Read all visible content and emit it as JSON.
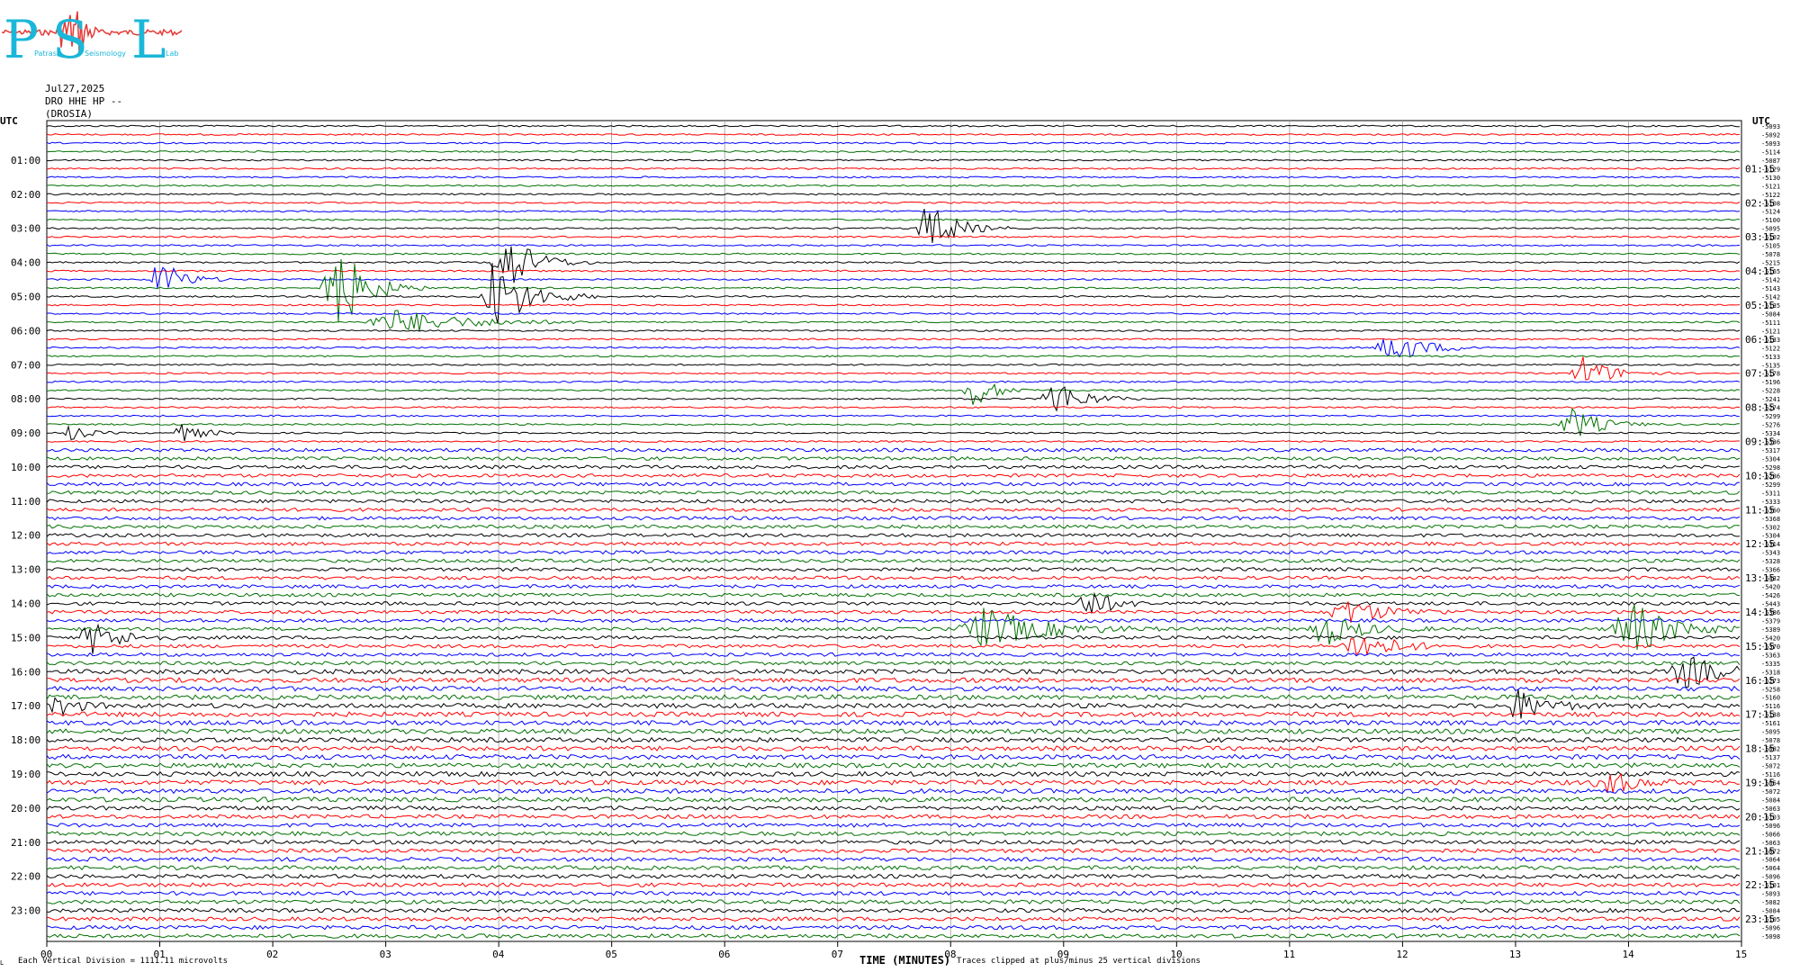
{
  "logo": {
    "letters": [
      "P",
      "S",
      "L"
    ],
    "subtitle_words": [
      "Patras",
      "Seismology",
      "Lab"
    ],
    "colors": {
      "letters": "#1ab7d9",
      "trace": "#e53935"
    }
  },
  "header": {
    "date": "Jul27,2025",
    "station_line": "DRO HHE HP --",
    "location": "(DROSIA)"
  },
  "footer": {
    "vertical_division": "Each Vertical Division = 1111.11 microvolts",
    "x_axis_title": "TIME (MINUTES)",
    "clip_note": "Traces clipped at plus/minus 25 vertical divisions",
    "corner_mark": "L"
  },
  "chart_data": {
    "type": "line",
    "description_kind": "helicorder",
    "left_axis_title": "UTC",
    "right_axis_title": "UTC",
    "x_ticks": [
      "00",
      "01",
      "02",
      "03",
      "04",
      "05",
      "06",
      "07",
      "08",
      "09",
      "10",
      "11",
      "12",
      "13",
      "14",
      "15"
    ],
    "xlim": [
      0,
      15
    ],
    "left_hour_labels": [
      "01:00",
      "02:00",
      "03:00",
      "04:00",
      "05:00",
      "06:00",
      "07:00",
      "08:00",
      "09:00",
      "10:00",
      "11:00",
      "12:00",
      "13:00",
      "14:00",
      "15:00",
      "16:00",
      "17:00",
      "18:00",
      "19:00",
      "20:00",
      "21:00",
      "22:00",
      "23:00"
    ],
    "right_hour_labels": [
      "01:15",
      "02:15",
      "03:15",
      "04:15",
      "05:15",
      "06:15",
      "07:15",
      "08:15",
      "09:15",
      "10:15",
      "11:15",
      "12:15",
      "13:15",
      "14:15",
      "15:15",
      "16:15",
      "17:15",
      "18:15",
      "19:15",
      "20:15",
      "21:15",
      "22:15",
      "23:15"
    ],
    "trace_colors": [
      "#000000",
      "#ff0000",
      "#0000ff",
      "#007000"
    ],
    "trace_count": 96,
    "trace_minutes": 15,
    "trace_offsets": [
      "-5093",
      "-5092",
      "-5093",
      "-5114",
      "-5087",
      "-5129",
      "-5130",
      "-5121",
      "-5122",
      "-5108",
      "-5124",
      "-5100",
      "-5095",
      "-5102",
      "-5105",
      "-5078",
      "-5215",
      "-5165",
      "-5142",
      "-5143",
      "-5142",
      "-5135",
      "-5084",
      "-5111",
      "-5121",
      "-5133",
      "-5122",
      "-5133",
      "-5135",
      "-5178",
      "-5196",
      "-5228",
      "-5241",
      "-5274",
      "-5299",
      "-5276",
      "-5334",
      "-5336",
      "-5317",
      "-5304",
      "-5298",
      "-5286",
      "-5299",
      "-5311",
      "-5333",
      "-5360",
      "-5368",
      "-5302",
      "-5304",
      "-5314",
      "-5343",
      "-5328",
      "-5366",
      "-5432",
      "-5420",
      "-5426",
      "-5443",
      "-5386",
      "-5379",
      "-5389",
      "-5420",
      "-5370",
      "-5363",
      "-5335",
      "-5318",
      "-5273",
      "-5258",
      "-5160",
      "-5116",
      "-5138",
      "-5161",
      "-5095",
      "-5078",
      "-5082",
      "-5137",
      "-5072",
      "-5116",
      "-5054",
      "-5072",
      "-5084",
      "-5063",
      "-5103",
      "-5096",
      "-5066",
      "-5063",
      "-5072",
      "-5064",
      "-5064",
      "-5096",
      "-5101",
      "-5093",
      "-5082",
      "-5084",
      "-5105",
      "-5096",
      "-5098"
    ],
    "events": [
      {
        "trace": 12,
        "minute": 7.8,
        "amplitude": 6,
        "duration": 0.5,
        "label": ""
      },
      {
        "trace": 16,
        "minute": 4.05,
        "amplitude": 8,
        "duration": 0.5,
        "label": ""
      },
      {
        "trace": 18,
        "minute": 1.0,
        "amplitude": 5,
        "duration": 0.4,
        "label": ""
      },
      {
        "trace": 19,
        "minute": 2.55,
        "amplitude": 12,
        "duration": 0.5,
        "label": ""
      },
      {
        "trace": 20,
        "minute": 3.95,
        "amplitude": 9,
        "duration": 0.6,
        "label": ""
      },
      {
        "trace": 23,
        "minute": 3.1,
        "amplitude": 3,
        "duration": 1.2,
        "label": ""
      },
      {
        "trace": 26,
        "minute": 11.9,
        "amplitude": 4,
        "duration": 0.6,
        "label": ""
      },
      {
        "trace": 29,
        "minute": 13.6,
        "amplitude": 4,
        "duration": 0.5,
        "label": ""
      },
      {
        "trace": 31,
        "minute": 8.2,
        "amplitude": 4,
        "duration": 0.4,
        "label": ""
      },
      {
        "trace": 32,
        "minute": 8.9,
        "amplitude": 5,
        "duration": 0.5,
        "label": ""
      },
      {
        "trace": 35,
        "minute": 13.5,
        "amplitude": 4,
        "duration": 0.5,
        "label": ""
      },
      {
        "trace": 36,
        "minute": 0.2,
        "amplitude": 2,
        "duration": 0.3,
        "label": ""
      },
      {
        "trace": 36,
        "minute": 1.2,
        "amplitude": 2,
        "duration": 0.4,
        "label": ""
      },
      {
        "trace": 56,
        "minute": 9.2,
        "amplitude": 4,
        "duration": 0.4,
        "label": ""
      },
      {
        "trace": 57,
        "minute": 11.5,
        "amplitude": 3,
        "duration": 0.7,
        "label": ""
      },
      {
        "trace": 59,
        "minute": 8.3,
        "amplitude": 5,
        "duration": 1.0,
        "label": ""
      },
      {
        "trace": 59,
        "minute": 11.3,
        "amplitude": 4,
        "duration": 0.6,
        "label": ""
      },
      {
        "trace": 59,
        "minute": 14.0,
        "amplitude": 7,
        "duration": 0.7,
        "label": ""
      },
      {
        "trace": 60,
        "minute": 0.4,
        "amplitude": 4,
        "duration": 0.5,
        "label": ""
      },
      {
        "trace": 61,
        "minute": 11.6,
        "amplitude": 4,
        "duration": 0.6,
        "label": ""
      },
      {
        "trace": 64,
        "minute": 14.5,
        "amplitude": 4,
        "duration": 0.6,
        "label": ""
      },
      {
        "trace": 68,
        "minute": 0.1,
        "amplitude": 3,
        "duration": 0.3,
        "label": ""
      },
      {
        "trace": 68,
        "minute": 13.0,
        "amplitude": 4,
        "duration": 0.5,
        "label": ""
      },
      {
        "trace": 77,
        "minute": 13.8,
        "amplitude": 3,
        "duration": 0.5,
        "label": ""
      }
    ]
  }
}
